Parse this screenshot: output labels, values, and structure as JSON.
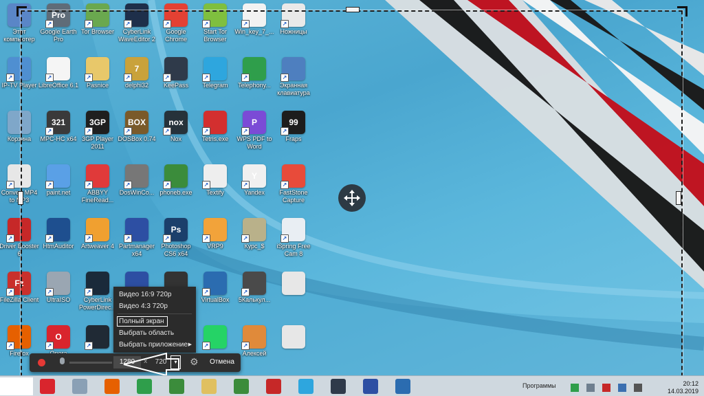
{
  "desktop": {
    "icons": [
      {
        "label": "Этот компьютер",
        "glyph": "",
        "color": "#5a86c7",
        "shortcut": false
      },
      {
        "label": "Google Earth Pro",
        "glyph": "Pro",
        "color": "#5f6c78",
        "shortcut": true
      },
      {
        "label": "Tor Browser",
        "glyph": "",
        "color": "#6aa84f",
        "shortcut": true
      },
      {
        "label": "CyberLink WaveEditor 2",
        "glyph": "",
        "color": "#1e2f4a",
        "shortcut": true
      },
      {
        "label": "Google Chrome",
        "glyph": "",
        "color": "#e34133",
        "shortcut": true
      },
      {
        "label": "Start Tor Browser",
        "glyph": "",
        "color": "#7fbf3f",
        "shortcut": true
      },
      {
        "label": "Win_key_7_...",
        "glyph": "",
        "color": "#f2f2f2",
        "shortcut": true
      },
      {
        "label": "Ножницы",
        "glyph": "",
        "color": "#e9e9e9",
        "shortcut": true
      },
      {
        "label": "IP-TV Player",
        "glyph": "",
        "color": "#4f8fd1",
        "shortcut": true
      },
      {
        "label": "LibreOffice 6.1",
        "glyph": "",
        "color": "#f5f5f5",
        "shortcut": true
      },
      {
        "label": "Pasnice",
        "glyph": "",
        "color": "#e8c86a",
        "shortcut": true
      },
      {
        "label": "delphi32",
        "glyph": "7",
        "color": "#c9a23b",
        "shortcut": true
      },
      {
        "label": "KeePass",
        "glyph": "",
        "color": "#2f3a4a",
        "shortcut": true
      },
      {
        "label": "Telegram",
        "glyph": "",
        "color": "#2ea6de",
        "shortcut": true
      },
      {
        "label": "Telephony...",
        "glyph": "",
        "color": "#2f9e4b",
        "shortcut": true
      },
      {
        "label": "Экранная клавиатура",
        "glyph": "",
        "color": "#4e7fbf",
        "shortcut": true
      },
      {
        "label": "Корзина",
        "glyph": "",
        "color": "#7fa7c9",
        "shortcut": false
      },
      {
        "label": "MPC-HC x64",
        "glyph": "321",
        "color": "#3a3a3a",
        "shortcut": true
      },
      {
        "label": "3GP Player 2011",
        "glyph": "3GP",
        "color": "#1f1f1f",
        "shortcut": true
      },
      {
        "label": "DOSBox 0.74",
        "glyph": "BOX",
        "color": "#7a5a2a",
        "shortcut": true
      },
      {
        "label": "Nox",
        "glyph": "nox",
        "color": "#26323a",
        "shortcut": true
      },
      {
        "label": "Tetris.exe",
        "glyph": "",
        "color": "#d32f2f",
        "shortcut": true
      },
      {
        "label": "WPS PDF to Word",
        "glyph": "P",
        "color": "#7b4bd6",
        "shortcut": true
      },
      {
        "label": "Fraps",
        "glyph": "99",
        "color": "#1d1d1d",
        "shortcut": true
      },
      {
        "label": "Convert MP4 to MP3",
        "glyph": "",
        "color": "#e7e7e7",
        "shortcut": true
      },
      {
        "label": "paint.net",
        "glyph": "",
        "color": "#5aa0e6",
        "shortcut": true
      },
      {
        "label": "ABBYY FineRead...",
        "glyph": "",
        "color": "#e03a3a",
        "shortcut": true
      },
      {
        "label": "DosWinCo...",
        "glyph": "",
        "color": "#777777",
        "shortcut": true
      },
      {
        "label": "phoneb.exe",
        "glyph": "",
        "color": "#3b8c3b",
        "shortcut": true
      },
      {
        "label": "Textify",
        "glyph": "",
        "color": "#eeeeee",
        "shortcut": true
      },
      {
        "label": "Yandex",
        "glyph": "Y",
        "color": "#f0f0f0",
        "shortcut": true
      },
      {
        "label": "FastStone Capture",
        "glyph": "",
        "color": "#e84b3a",
        "shortcut": true
      },
      {
        "label": "Driver Booster 6",
        "glyph": "",
        "color": "#c62828",
        "shortcut": true
      },
      {
        "label": "HtmAuditor",
        "glyph": "",
        "color": "#1e4f8f",
        "shortcut": true
      },
      {
        "label": "Artweaver 4",
        "glyph": "",
        "color": "#f0a030",
        "shortcut": true
      },
      {
        "label": "Partmanager x64",
        "glyph": "",
        "color": "#2d4fa3",
        "shortcut": true
      },
      {
        "label": "Photoshop CS6 x64",
        "glyph": "Ps",
        "color": "#1b3f6b",
        "shortcut": true
      },
      {
        "label": "VRP9",
        "glyph": "",
        "color": "#f2a33a",
        "shortcut": true
      },
      {
        "label": "Курс_$",
        "glyph": "",
        "color": "#b9b18a",
        "shortcut": true
      },
      {
        "label": "iSpring Free Cam 8",
        "glyph": "",
        "color": "#e9eef3",
        "shortcut": true
      },
      {
        "label": "FileZilla Client",
        "glyph": "Fz",
        "color": "#c9302c",
        "shortcut": true
      },
      {
        "label": "UltraISO",
        "glyph": "",
        "color": "#9aa6b2",
        "shortcut": true
      },
      {
        "label": "CyberLink PowerDirec...",
        "glyph": "",
        "color": "#1a2a3a",
        "shortcut": true
      },
      {
        "label": "",
        "glyph": "",
        "color": "#2d4fa3",
        "shortcut": false
      },
      {
        "label": "",
        "glyph": "",
        "color": "#333333",
        "shortcut": false
      },
      {
        "label": "VirtualBox",
        "glyph": "",
        "color": "#2b6cb0",
        "shortcut": true
      },
      {
        "label": "5Калькул...",
        "glyph": "",
        "color": "#4a4a4a",
        "shortcut": true
      },
      {
        "label": "",
        "glyph": "",
        "color": "#e7e7e7",
        "shortcut": false
      },
      {
        "label": "Firefox",
        "glyph": "",
        "color": "#e66000",
        "shortcut": true
      },
      {
        "label": "Opera",
        "glyph": "O",
        "color": "#d9252d",
        "shortcut": true
      },
      {
        "label": "",
        "glyph": "",
        "color": "#202a35",
        "shortcut": true
      },
      {
        "label": "",
        "glyph": "",
        "color": "#2d4fa3",
        "shortcut": false
      },
      {
        "label": "",
        "glyph": "",
        "color": "#444444",
        "shortcut": false
      },
      {
        "label": "",
        "glyph": "",
        "color": "#25d366",
        "shortcut": true
      },
      {
        "label": "Алексей",
        "glyph": "",
        "color": "#e08a3a",
        "shortcut": true
      },
      {
        "label": "",
        "glyph": "",
        "color": "#e7e7e7",
        "shortcut": false
      }
    ]
  },
  "menu": {
    "items": [
      {
        "label": "Видео 16:9 720p",
        "submenu": false,
        "selected": false
      },
      {
        "label": "Видео 4:3 720p",
        "submenu": false,
        "selected": false
      },
      {
        "label": "Полный экран",
        "submenu": false,
        "selected": true
      },
      {
        "label": "Выбрать область",
        "submenu": false,
        "selected": false
      },
      {
        "label": "Выбрать приложение",
        "submenu": true,
        "selected": false
      }
    ]
  },
  "toolbar": {
    "width_value": "1280",
    "separator": "x",
    "height_value": "720",
    "cancel_label": "Отмена",
    "record_color": "#e53935"
  },
  "taskbar": {
    "tray_text": "Программы",
    "clock_time": "20:12",
    "clock_date": "14.03.2019",
    "icons": [
      "#d9252d",
      "#8aa0b5",
      "#e66000",
      "#2f9e4b",
      "#3b8c3b",
      "#e0c060",
      "#3b8c3b",
      "#c62828",
      "#2ea6de",
      "#2f3a4a",
      "#2d4fa3",
      "#2b6cb0"
    ]
  },
  "colors": {
    "desktop_blue": "#4aa6cf",
    "stripe_red": "#c1121f",
    "selection_border": "#1a1a1a",
    "menu_bg": "#2b2b2b",
    "toolbar_bg": "#2f2f2f"
  }
}
